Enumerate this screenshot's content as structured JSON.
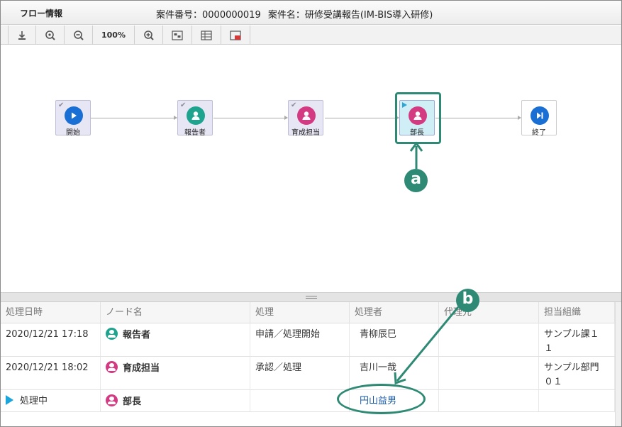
{
  "header": {
    "title": "フロー情報",
    "case_number": "案件番号：0000000019",
    "case_name": "案件名：研修受講報告(IM-BIS導入研修)"
  },
  "toolbar": {
    "buttons": [
      "download-icon",
      "zoom-fit-icon",
      "zoom-out-icon",
      "zoom-level",
      "zoom-in-icon",
      "image-icon",
      "table-icon",
      "window-icon"
    ],
    "zoom_label": "100%"
  },
  "flow": {
    "nodes": [
      {
        "label": "開始",
        "icon": "play-icon",
        "color": "#1a6fd4",
        "state": "done"
      },
      {
        "label": "報告者",
        "icon": "person-icon",
        "color": "#1ea38e",
        "state": "done"
      },
      {
        "label": "育成担当",
        "icon": "person-icon",
        "color": "#d43a82",
        "state": "done"
      },
      {
        "label": "部長",
        "icon": "person-icon",
        "color": "#d43a82",
        "state": "current"
      },
      {
        "label": "終了",
        "icon": "end-icon",
        "color": "#1a6fd4",
        "state": "pending"
      }
    ],
    "check_mark": "✔"
  },
  "annotations": {
    "a": "a",
    "b": "b",
    "color": "#2e8a74"
  },
  "table": {
    "headers": [
      "処理日時",
      "ノード名",
      "処理",
      "処理者",
      "代理先",
      "担当組織"
    ],
    "rows": [
      {
        "date": "2020/12/21 17:18",
        "node": "報告者",
        "node_color": "#1ea38e",
        "action": "申請／処理開始",
        "user": "青柳辰巳",
        "proxy": "",
        "org_line1": "サンプル課１",
        "org_line2": "１"
      },
      {
        "date": "2020/12/21 18:02",
        "node": "育成担当",
        "node_color": "#d43a82",
        "action": "承認／処理",
        "user": "吉川一哉",
        "proxy": "",
        "org_line1": "サンプル部門",
        "org_line2": "０１"
      },
      {
        "date": "処理中",
        "node": "部長",
        "node_color": "#d43a82",
        "action": "",
        "user": "円山益男",
        "proxy": "",
        "org_line1": "",
        "org_line2": ""
      }
    ]
  }
}
